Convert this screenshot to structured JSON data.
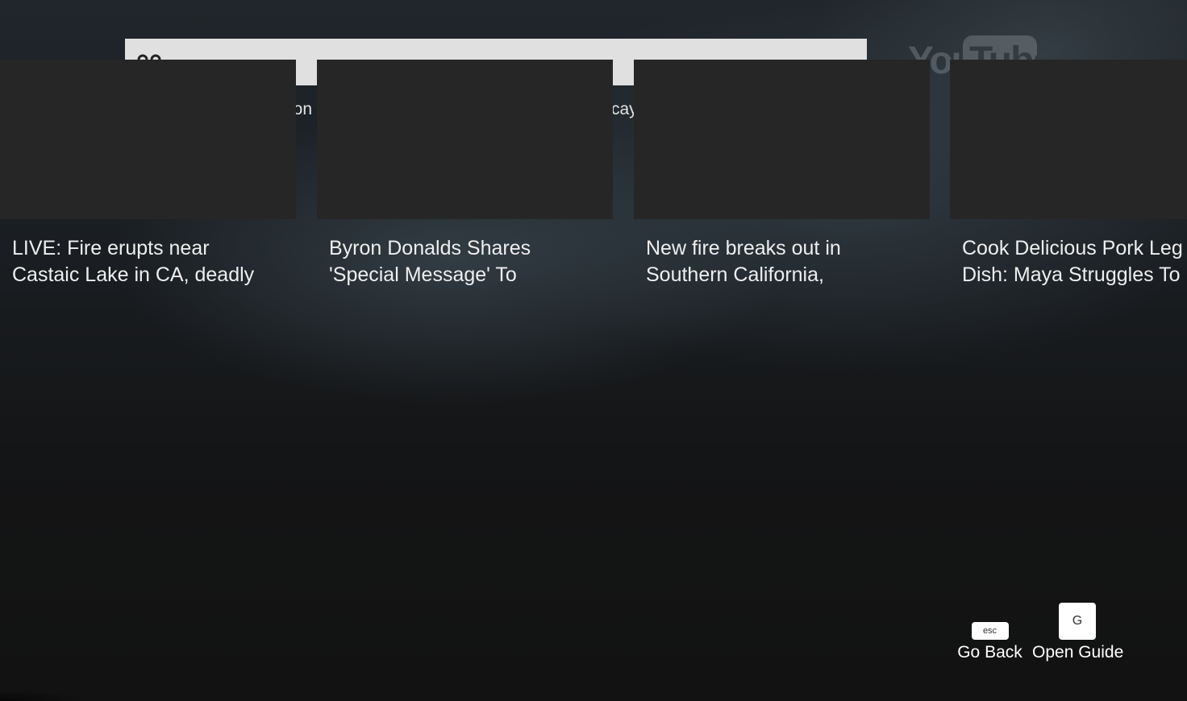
{
  "search": {
    "fragment_left": "oon",
    "fragment_right": "cay"
  },
  "logo": {
    "you": "You",
    "tube": "Tube"
  },
  "videos": [
    {
      "title_line1": "LIVE: Fire erupts near",
      "title_line2": "Castaic Lake in CA, deadly"
    },
    {
      "title_line1": "Byron Donalds Shares",
      "title_line2": "'Special Message' To"
    },
    {
      "title_line1": "New fire breaks out in",
      "title_line2": "Southern California,"
    },
    {
      "title_line1": "Cook Delicious Pork Leg",
      "title_line2": "Dish: Maya Struggles To"
    }
  ],
  "hints": {
    "back_key": "esc",
    "back_label": "Go Back",
    "guide_key": "G",
    "guide_label": "Open Guide"
  },
  "colors": {
    "search_bar": "#e0e0e0",
    "thumbnail": "#262626",
    "background": "#121212"
  }
}
